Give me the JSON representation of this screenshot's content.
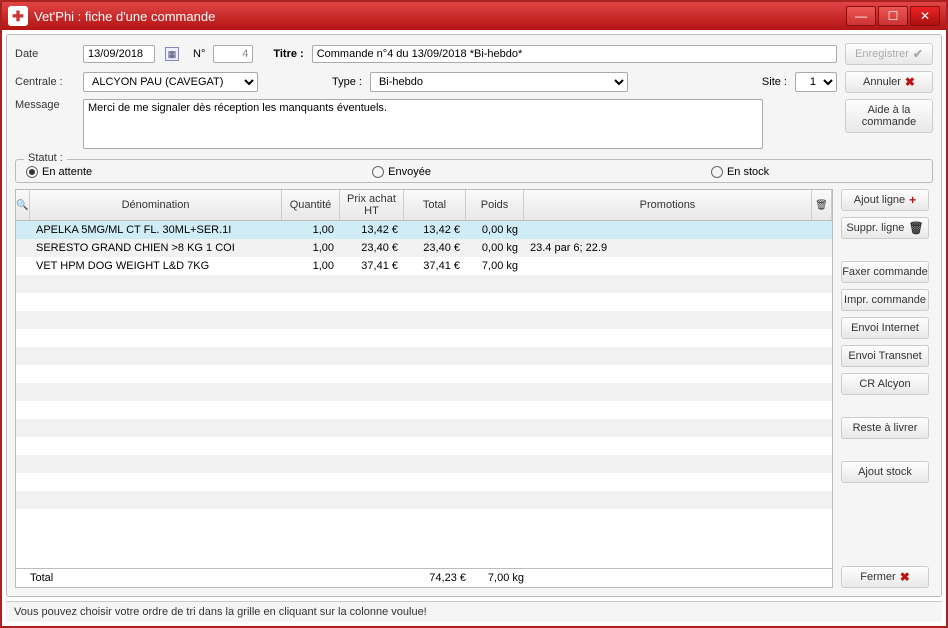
{
  "window": {
    "title": "Vet'Phi : fiche d'une commande"
  },
  "form": {
    "date_label": "Date",
    "date_value": "13/09/2018",
    "num_label": "N°",
    "num_value": "4",
    "titre_label": "Titre :",
    "titre_value": "Commande n°4 du 13/09/2018 *Bi-hebdo*",
    "centrale_label": "Centrale :",
    "centrale_value": "ALCYON PAU (CAVEGAT)",
    "type_label": "Type :",
    "type_value": "Bi-hebdo",
    "site_label": "Site :",
    "site_value": "1",
    "message_label": "Message",
    "message_value": "Merci de me signaler dès réception les manquants éventuels.",
    "statut_label": "Statut :",
    "statut_options": {
      "attente": "En attente",
      "envoyee": "Envoyée",
      "stock": "En stock"
    }
  },
  "buttons": {
    "enregistrer": "Enregistrer",
    "annuler": "Annuler",
    "aide": "Aide à la commande",
    "ajout_ligne": "Ajout ligne",
    "suppr_ligne": "Suppr. ligne",
    "faxer": "Faxer commande",
    "impr": "Impr. commande",
    "envoi_internet": "Envoi Internet",
    "envoi_transnet": "Envoi Transnet",
    "cr_alcyon": "CR Alcyon",
    "reste_livrer": "Reste à livrer",
    "ajout_stock": "Ajout stock",
    "fermer": "Fermer"
  },
  "grid": {
    "headers": {
      "denom": "Dénomination",
      "qty": "Quantité",
      "prix": "Prix achat HT",
      "total": "Total",
      "poids": "Poids",
      "promo": "Promotions"
    },
    "rows": [
      {
        "denom": "APELKA 5MG/ML CT       FL. 30ML+SER.1I",
        "qty": "1,00",
        "prix": "13,42 €",
        "total": "13,42 €",
        "poids": "0,00 kg",
        "promo": "",
        "selected": true
      },
      {
        "denom": "SERESTO GRAND CHIEN >8 KG     1 COI",
        "qty": "1,00",
        "prix": "23,40 €",
        "total": "23,40 €",
        "poids": "0,00 kg",
        "promo": "23.4 par 6; 22.9"
      },
      {
        "denom": "VET HPM DOG WEIGHT L&D 7KG",
        "qty": "1,00",
        "prix": "37,41 €",
        "total": "37,41 €",
        "poids": "7,00 kg",
        "promo": ""
      }
    ],
    "total_label": "Total",
    "total_value": "74,23 €",
    "total_poids": "7,00 kg"
  },
  "status_bar": "Vous pouvez choisir votre ordre de tri dans la grille en cliquant sur la colonne voulue!"
}
